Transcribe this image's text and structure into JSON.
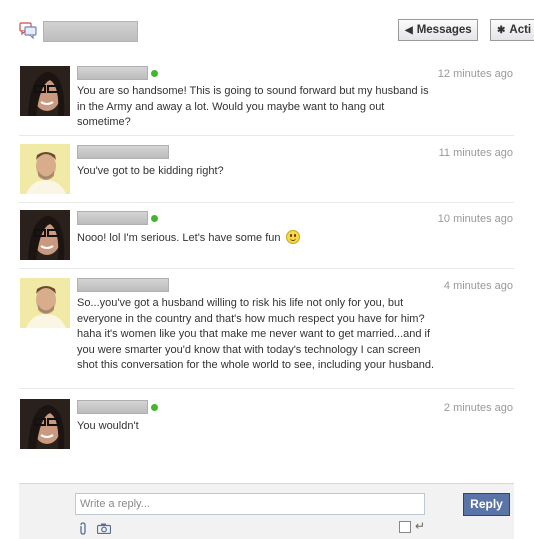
{
  "header": {
    "messages_button": "Messages",
    "actions_button": "Acti",
    "messages_icon": "chevron-left-icon",
    "actions_icon": "gear-icon"
  },
  "messages": [
    {
      "sender": "woman",
      "online": true,
      "time": "12 minutes ago",
      "text": "You are so handsome! This is going to sound forward but my husband is in the Army and away a lot. Would you maybe want to hang out sometime?"
    },
    {
      "sender": "man",
      "online": false,
      "time": "11 minutes ago",
      "text": "You've got to be kidding right?"
    },
    {
      "sender": "woman",
      "online": true,
      "time": "10 minutes ago",
      "text": "Nooo! lol I'm serious. Let's have some fun",
      "emoji": "smiley-icon"
    },
    {
      "sender": "man",
      "online": false,
      "time": "4 minutes ago",
      "text": "So...you've got a husband willing to risk his life not only for you, but everyone in the country and that's how much respect you have for him? haha it's women like you that make me never want to get married...and if you were smarter you'd know that with today's technology I can screen shot this conversation for the whole world to see, including your husband."
    },
    {
      "sender": "woman",
      "online": true,
      "time": "2 minutes ago",
      "text": "You wouldn't"
    }
  ],
  "composer": {
    "placeholder": "Write a reply...",
    "reply_button": "Reply",
    "enter_symbol": "↵"
  },
  "colors": {
    "online": "#42b72a",
    "reply_button": "#5b74a8",
    "timestamp": "#999999"
  }
}
